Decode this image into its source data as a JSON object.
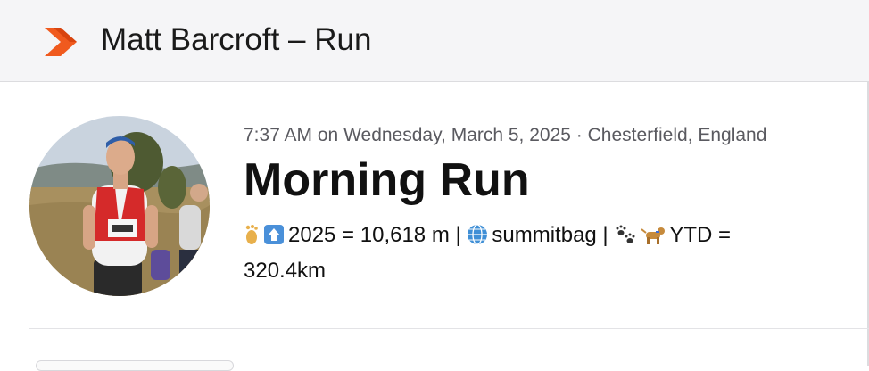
{
  "header": {
    "title": "Matt Barcroft – Run",
    "logo_icon": "strava-chevron-icon",
    "brand_color": "#fc4c02"
  },
  "activity": {
    "meta": "7:37 AM on Wednesday, March 5, 2025 · Chesterfield, England",
    "title": "Morning Run",
    "description_line1": "2025 = 10,618 m | ",
    "description_site": "summitbag | ",
    "description_ytd": "YTD =",
    "description_line2": "320.4km",
    "emoji_icons": [
      "footprint-icon",
      "up-arrow-icon",
      "globe-icon",
      "paw-prints-icon",
      "dog-icon"
    ]
  }
}
